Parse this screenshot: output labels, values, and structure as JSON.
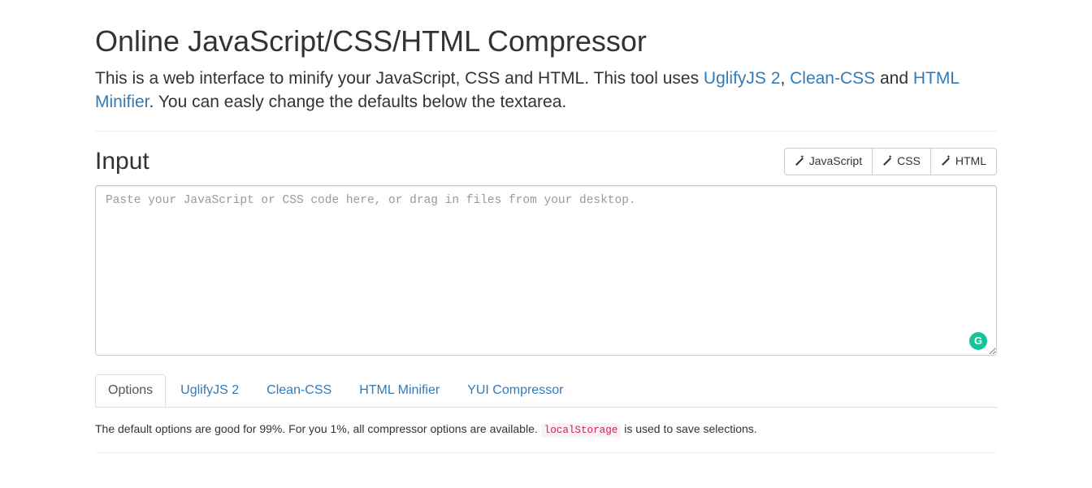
{
  "header": {
    "title": "Online JavaScript/CSS/HTML Compressor",
    "lead_part1": "This is a web interface to minify your JavaScript, CSS and HTML. This tool uses ",
    "link_uglify": "UglifyJS 2",
    "sep1": ", ",
    "link_cleancss": "Clean-CSS",
    "sep2": " and ",
    "link_htmlmin": "HTML Minifier",
    "lead_part2": ". You can easly change the defaults below the textarea."
  },
  "input": {
    "heading": "Input",
    "buttons": {
      "js": "JavaScript",
      "css": "CSS",
      "html": "HTML"
    },
    "placeholder": "Paste your JavaScript or CSS code here, or drag in files from your desktop.",
    "value": "",
    "badge_letter": "G"
  },
  "tabs": {
    "options": "Options",
    "uglify": "UglifyJS 2",
    "cleancss": "Clean-CSS",
    "htmlmin": "HTML Minifier",
    "yui": "YUI Compressor"
  },
  "note": {
    "part1": "The default options are good for 99%. For you 1%, all compressor options are available. ",
    "code": "localStorage",
    "part2": " is used to save selections."
  }
}
